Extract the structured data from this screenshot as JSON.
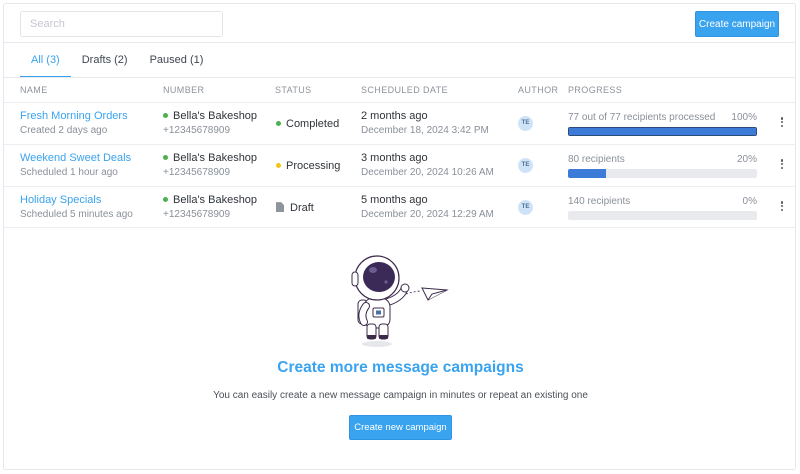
{
  "search": {
    "placeholder": "Search"
  },
  "actions": {
    "create_campaign": "Create campaign"
  },
  "tabs": [
    {
      "label": "All (3)",
      "active": true
    },
    {
      "label": "Drafts (2)",
      "active": false
    },
    {
      "label": "Paused (1)",
      "active": false
    }
  ],
  "columns": {
    "name": "NAME",
    "number": "NUMBER",
    "status": "STATUS",
    "scheduled_date": "SCHEDULED DATE",
    "author": "AUTHOR",
    "progress": "PROGRESS"
  },
  "rows": [
    {
      "name": "Fresh Morning Orders",
      "subtitle": "Created 2 days ago",
      "sender": "Bella's Bakeshop",
      "phone": "+12345678909",
      "status": "Completed",
      "status_color": "#4caf50",
      "relative_date": "2 months ago",
      "date": "December 18, 2024 3:42 PM",
      "author": "TE",
      "progress_label": "77 out of 77 recipients processed",
      "progress_pct": "100%",
      "progress_value": 100
    },
    {
      "name": "Weekend Sweet Deals",
      "subtitle": "Scheduled 1 hour ago",
      "sender": "Bella's Bakeshop",
      "phone": "+12345678909",
      "status": "Processing",
      "status_color": "#f5c518",
      "relative_date": "3 months ago",
      "date": "December 20, 2024 10:26 AM",
      "author": "TE",
      "progress_label": "80 recipients",
      "progress_pct": "20%",
      "progress_value": 20
    },
    {
      "name": "Holiday Specials",
      "subtitle": "Scheduled 5 minutes ago",
      "sender": "Bella's Bakeshop",
      "phone": "+12345678909",
      "status": "Draft",
      "status_color": "#8e949b",
      "relative_date": "5 months ago",
      "date": "December 20, 2024 12:29 AM",
      "author": "TE",
      "progress_label": "140 recipients",
      "progress_pct": "0%",
      "progress_value": 0
    }
  ],
  "empty_state": {
    "title": "Create more message campaigns",
    "subtitle": "You can easily create a new message campaign in minutes or repeat an existing one",
    "button": "Create new campaign"
  },
  "colors": {
    "accent": "#3aa3ef",
    "progress_fill": "#3d7bd9",
    "success": "#4caf50",
    "warning": "#f5c518"
  }
}
